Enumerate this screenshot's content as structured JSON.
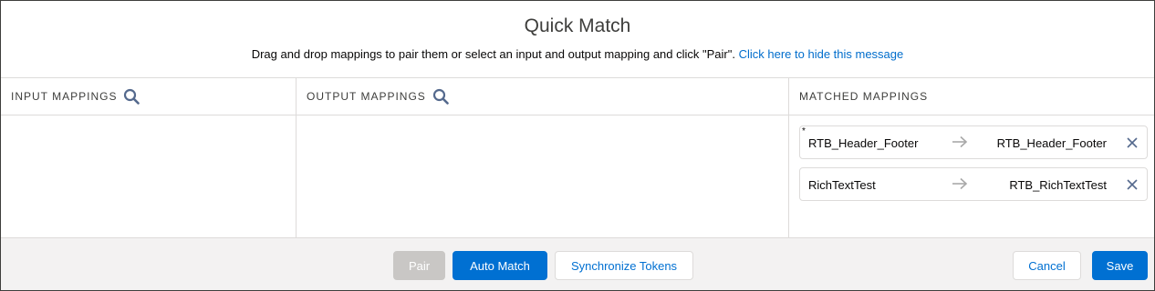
{
  "header": {
    "title": "Quick Match",
    "message": "Drag and drop mappings to pair them or select an input and output mapping and click \"Pair\".",
    "hide_link": "Click here to hide this message"
  },
  "columns": {
    "input": {
      "label": "INPUT MAPPINGS",
      "search_icon": "search-icon"
    },
    "output": {
      "label": "OUTPUT MAPPINGS",
      "search_icon": "search-icon"
    },
    "matched": {
      "label": "MATCHED MAPPINGS"
    }
  },
  "matched": [
    {
      "marker": "*",
      "input": "RTB_Header_Footer",
      "arrow_icon": "arrow-right-icon",
      "output": "RTB_Header_Footer",
      "remove_icon": "close-icon"
    },
    {
      "marker": "",
      "input": "RichTextTest",
      "arrow_icon": "arrow-right-icon",
      "output": "RTB_RichTextTest",
      "remove_icon": "close-icon"
    }
  ],
  "footer": {
    "pair": "Pair",
    "auto_match": "Auto Match",
    "synchronize": "Synchronize Tokens",
    "cancel": "Cancel",
    "save": "Save"
  },
  "colors": {
    "brand": "#0070d2",
    "link": "#006dcc",
    "disabled": "#c9c7c5",
    "border": "#dddbda",
    "footer_bg": "#f3f2f2"
  }
}
